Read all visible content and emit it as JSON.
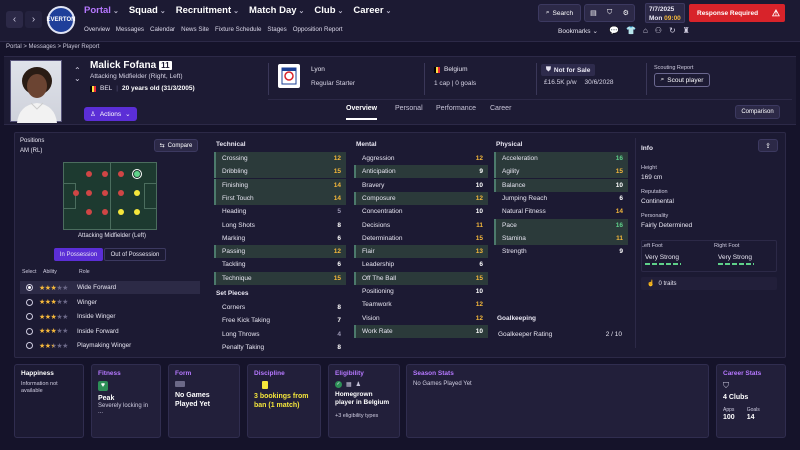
{
  "topbar": {
    "back_icon": "chevron-left-icon",
    "forward_icon": "chevron-right-icon",
    "club_badge": "EVERTON",
    "nav": [
      {
        "label": "Portal",
        "active": true
      },
      {
        "label": "Squad"
      },
      {
        "label": "Recruitment"
      },
      {
        "label": "Match Day"
      },
      {
        "label": "Club"
      },
      {
        "label": "Career"
      }
    ],
    "subnav": [
      "Overview",
      "Messages",
      "Calendar",
      "News Site",
      "Fixture Schedule",
      "Stages",
      "Opposition Report"
    ],
    "search_label": "Search",
    "date_line1": "7/7/2025",
    "date_line2": "Mon",
    "time": "09:00",
    "response_label": "Response Required",
    "bookmarks_label": "Bookmarks"
  },
  "breadcrumb": [
    "Portal",
    "Messages",
    "Player Report"
  ],
  "player": {
    "name": "Malick Fofana",
    "number": "11",
    "position": "Attacking Midfielder (Right, Left)",
    "nation_code": "BEL",
    "age": "20 years old (31/3/2005)",
    "actions_label": "Actions",
    "club": "Lyon",
    "status": "Regular Starter",
    "nation": "Belgium",
    "caps": "1 cap | 0 goals",
    "sale_label": "Not for Sale",
    "wage": "£16.5K p/w",
    "contract": "30/6/2028",
    "scouting_title": "Scouting Report",
    "scout_btn": "Scout player"
  },
  "tabs": [
    "Overview",
    "Personal",
    "Performance",
    "Career"
  ],
  "comparison_label": "Comparison",
  "positions": {
    "title": "Positions",
    "current": "AM (RL)",
    "compare_label": "Compare",
    "role_caption": "Attacking Midfielder (Left)",
    "toggle_in": "In Possession",
    "toggle_out": "Out of Possession",
    "col_select": "Select",
    "col_ability": "Ability",
    "col_role": "Role",
    "roles": [
      {
        "name": "Wide Forward",
        "stars": 3,
        "selected": true
      },
      {
        "name": "Winger",
        "stars": 3
      },
      {
        "name": "Inside Winger",
        "stars": 3
      },
      {
        "name": "Inside Forward",
        "stars": 3
      },
      {
        "name": "Playmaking Winger",
        "stars": 2.5
      }
    ]
  },
  "technical": {
    "title": "Technical",
    "attrs": [
      {
        "name": "Crossing",
        "value": "12",
        "color": "gold",
        "hl": true
      },
      {
        "name": "Dribbling",
        "value": "15",
        "color": "gold",
        "hl": true
      },
      {
        "name": "Finishing",
        "value": "14",
        "color": "gold",
        "hl": true
      },
      {
        "name": "First Touch",
        "value": "14",
        "color": "gold",
        "hl": true
      },
      {
        "name": "Heading",
        "value": "5",
        "color": "dim"
      },
      {
        "name": "Long Shots",
        "value": "8",
        "color": "white"
      },
      {
        "name": "Marking",
        "value": "6",
        "color": "white"
      },
      {
        "name": "Passing",
        "value": "12",
        "color": "gold",
        "hl": true
      },
      {
        "name": "Tackling",
        "value": "6",
        "color": "white"
      },
      {
        "name": "Technique",
        "value": "15",
        "color": "gold",
        "hl": true
      }
    ]
  },
  "setpieces": {
    "title": "Set Pieces",
    "attrs": [
      {
        "name": "Corners",
        "value": "8",
        "color": "white"
      },
      {
        "name": "Free Kick Taking",
        "value": "7",
        "color": "white"
      },
      {
        "name": "Long Throws",
        "value": "4",
        "color": "dim"
      },
      {
        "name": "Penalty Taking",
        "value": "8",
        "color": "white"
      }
    ]
  },
  "mental": {
    "title": "Mental",
    "attrs": [
      {
        "name": "Aggression",
        "value": "12",
        "color": "gold"
      },
      {
        "name": "Anticipation",
        "value": "9",
        "color": "white",
        "hl": true
      },
      {
        "name": "Bravery",
        "value": "10",
        "color": "white"
      },
      {
        "name": "Composure",
        "value": "12",
        "color": "gold",
        "hl": true
      },
      {
        "name": "Concentration",
        "value": "10",
        "color": "white"
      },
      {
        "name": "Decisions",
        "value": "11",
        "color": "gold"
      },
      {
        "name": "Determination",
        "value": "15",
        "color": "gold"
      },
      {
        "name": "Flair",
        "value": "13",
        "color": "gold",
        "hl": true
      },
      {
        "name": "Leadership",
        "value": "6",
        "color": "white"
      },
      {
        "name": "Off The Ball",
        "value": "15",
        "color": "gold",
        "hl": true
      },
      {
        "name": "Positioning",
        "value": "10",
        "color": "white"
      },
      {
        "name": "Teamwork",
        "value": "12",
        "color": "gold"
      },
      {
        "name": "Vision",
        "value": "12",
        "color": "gold"
      },
      {
        "name": "Work Rate",
        "value": "10",
        "color": "white",
        "hl": true
      }
    ]
  },
  "physical": {
    "title": "Physical",
    "attrs": [
      {
        "name": "Acceleration",
        "value": "16",
        "color": "green",
        "hl": true
      },
      {
        "name": "Agility",
        "value": "15",
        "color": "gold",
        "hl": true
      },
      {
        "name": "Balance",
        "value": "10",
        "color": "white",
        "hl": true
      },
      {
        "name": "Jumping Reach",
        "value": "6",
        "color": "white"
      },
      {
        "name": "Natural Fitness",
        "value": "14",
        "color": "gold"
      },
      {
        "name": "Pace",
        "value": "16",
        "color": "green",
        "hl": true
      },
      {
        "name": "Stamina",
        "value": "11",
        "color": "gold",
        "hl": true
      },
      {
        "name": "Strength",
        "value": "9",
        "color": "white"
      }
    ]
  },
  "goalkeeping": {
    "title": "Goalkeeping",
    "rating_label": "Goalkeeper Rating",
    "rating_value": "2 / 10"
  },
  "info": {
    "title": "Info",
    "height_label": "Height",
    "height": "169 cm",
    "reputation_label": "Reputation",
    "reputation": "Continental",
    "personality_label": "Personality",
    "personality": "Fairly Determined",
    "left_foot_label": "Left Foot",
    "left_foot": "Very Strong",
    "right_foot_label": "Right Foot",
    "right_foot": "Very Strong",
    "traits": "0 traits"
  },
  "cards": {
    "happiness": {
      "title": "Happiness",
      "text": "Information not available"
    },
    "fitness": {
      "title": "Fitness",
      "value": "Peak",
      "sub": "Severely locking in ..."
    },
    "form": {
      "title": "Form",
      "value": "No Games Played Yet"
    },
    "discipline": {
      "title": "Discipline",
      "value": "3 bookings from ban (1 match)"
    },
    "eligibility": {
      "title": "Eligibility",
      "value": "Homegrown player in Belgium",
      "sub": "+3 eligibility types"
    },
    "season": {
      "title": "Season Stats",
      "text": "No Games Played Yet"
    },
    "career": {
      "title": "Career Stats",
      "value": "4 Clubs",
      "apps_label": "Apps",
      "apps": "100",
      "goals_label": "Goals",
      "goals": "14"
    }
  },
  "colors": {
    "accent": "#b678ff",
    "gold": "#f5b83b",
    "green": "#5fd18a",
    "alert": "#d8232a"
  }
}
